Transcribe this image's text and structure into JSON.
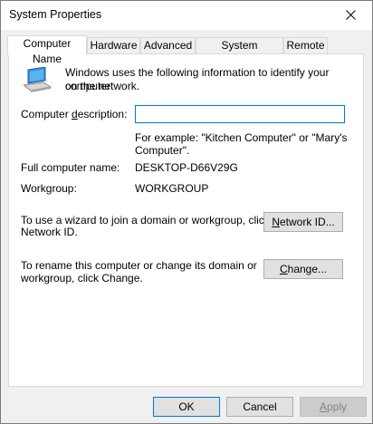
{
  "window": {
    "title": "System Properties",
    "close_label": "close"
  },
  "tabs": [
    {
      "label": "Computer Name",
      "active": true
    },
    {
      "label": "Hardware",
      "active": false
    },
    {
      "label": "Advanced",
      "active": false
    },
    {
      "label": "System Protection",
      "active": false
    },
    {
      "label": "Remote",
      "active": false
    }
  ],
  "panel": {
    "intro_line1": "Windows uses the following information to identify your computer",
    "intro_line2": "on the network.",
    "description_label_pre": "Computer ",
    "description_label_ul": "d",
    "description_label_post": "escription:",
    "description_value": "",
    "example_line1": "For example: \"Kitchen Computer\" or \"Mary's",
    "example_line2": "Computer\".",
    "full_name_label": "Full computer name:",
    "full_name_value": "DESKTOP-D66V29G",
    "workgroup_label": "Workgroup:",
    "workgroup_value": "WORKGROUP",
    "wizard_line1": "To use a wizard to join a domain or workgroup, click",
    "wizard_line2": "Network ID.",
    "network_id_button_ul": "N",
    "network_id_button_rest": "etwork ID...",
    "rename_line1": "To rename this computer or change its domain or",
    "rename_line2": "workgroup, click Change.",
    "change_button_ul": "C",
    "change_button_rest": "hange..."
  },
  "footer": {
    "ok_label": "OK",
    "cancel_label": "Cancel",
    "apply_ul": "A",
    "apply_rest": "pply"
  },
  "icons": {
    "computer": "computer-icon",
    "close": "close-icon"
  }
}
